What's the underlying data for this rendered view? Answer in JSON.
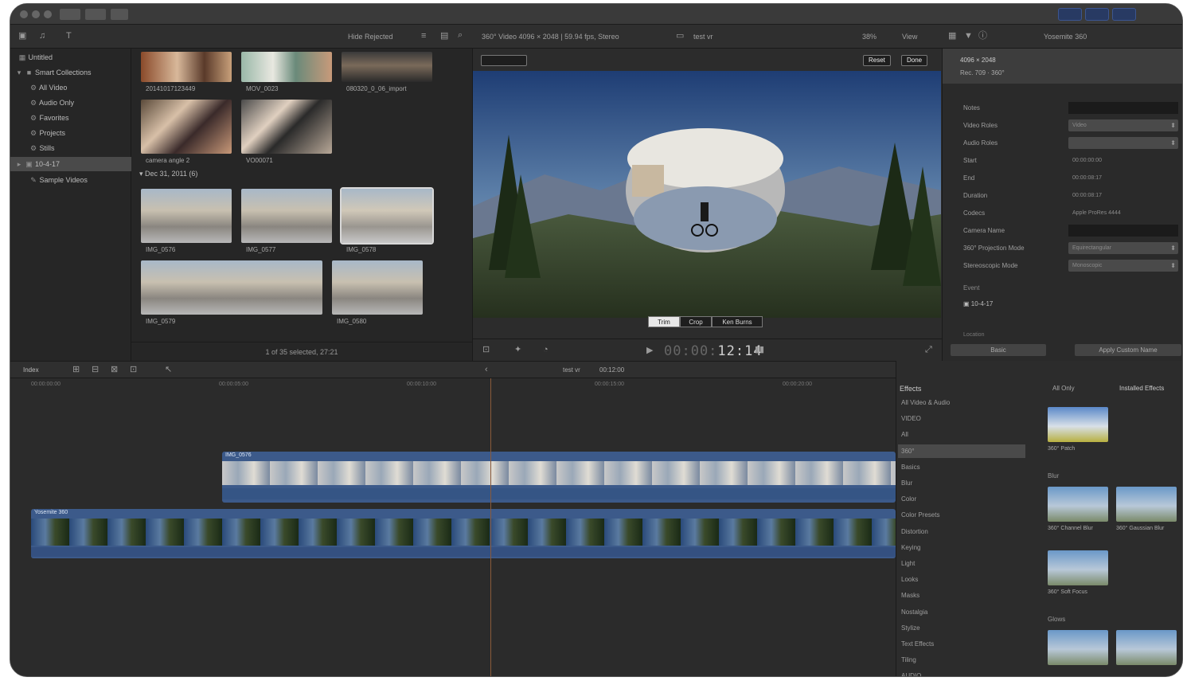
{
  "toolbar": {
    "filter": "Hide Rejected",
    "clip_info": "360° Video 4096 × 2048 | 59.94 fps, Stereo",
    "viewer_label": "test vr",
    "zoom": "38%",
    "view_menu": "View",
    "inspector_title": "Yosemite 360"
  },
  "sidebar": {
    "items": [
      {
        "label": "Untitled",
        "icon": "library-icon"
      },
      {
        "label": "Smart Collections",
        "icon": "folder-icon"
      },
      {
        "label": "All Video",
        "icon": "smart-collection-icon"
      },
      {
        "label": "Audio Only",
        "icon": "smart-collection-icon"
      },
      {
        "label": "Favorites",
        "icon": "smart-collection-icon"
      },
      {
        "label": "Projects",
        "icon": "smart-collection-icon"
      },
      {
        "label": "Stills",
        "icon": "smart-collection-icon"
      },
      {
        "label": "10-4-17",
        "icon": "event-icon"
      },
      {
        "label": "Sample Videos",
        "icon": "keyword-icon"
      }
    ]
  },
  "browser": {
    "clips_top": [
      "20141017123449",
      "MOV_0023",
      "080320_0_06_import"
    ],
    "clips_mid": [
      "camera angle 2",
      "VO00071"
    ],
    "group_header": "Dec 31, 2011  (6)",
    "clips_group": [
      "IMG_0576",
      "IMG_0577",
      "IMG_0578",
      "IMG_0579",
      "IMG_0580"
    ],
    "status": "1 of 35 selected, 27:21"
  },
  "viewer": {
    "top_buttons": [
      "Reset",
      "Done"
    ],
    "mode_tabs": [
      "Trim",
      "Crop",
      "Ken Burns"
    ],
    "timecode_dim": "00:00:",
    "timecode": "12:14"
  },
  "inspector": {
    "header_title": "4096 × 2048",
    "header_sub": "Rec. 709 · 360°",
    "rows": [
      {
        "key": "Notes",
        "value": "",
        "style": "dark"
      },
      {
        "key": "Video Roles",
        "value": "Video",
        "style": "pop"
      },
      {
        "key": "Audio Roles",
        "value": "",
        "style": "pop"
      },
      {
        "key": "Start",
        "value": "00:00:00:00",
        "style": "plain"
      },
      {
        "key": "End",
        "value": "00:00:08:17",
        "style": "plain"
      },
      {
        "key": "Duration",
        "value": "00:00:08:17",
        "style": "plain"
      },
      {
        "key": "Codecs",
        "value": "Apple ProRes 4444",
        "style": "plain"
      },
      {
        "key": "Camera Name",
        "value": "",
        "style": "dark"
      },
      {
        "key": "360° Projection Mode",
        "value": "Equirectangular",
        "style": "pop"
      },
      {
        "key": "Stereoscopic Mode",
        "value": "Monoscopic",
        "style": "pop"
      }
    ],
    "event_label": "Event",
    "event_value": "10-4-17",
    "location_label": "Location",
    "basic_button": "Basic",
    "apply_button": "Apply Custom Name"
  },
  "timeline": {
    "index_button": "Index",
    "project_name": "test vr",
    "project_duration": "00:12:00",
    "ruler": [
      "00:00:00:00",
      "00:00:05:00",
      "00:00:10:00",
      "00:00:15:00",
      "00:00:20:00"
    ],
    "clip_upper": "IMG_0576",
    "clip_lower": "Yosemite 360"
  },
  "effects": {
    "header": "Effects",
    "header_right": "All Only",
    "installed": "Installed Effects",
    "categories": [
      "All Video & Audio",
      "VIDEO",
      "All",
      "360°",
      "Basics",
      "Blur",
      "Color",
      "Color Presets",
      "Distortion",
      "Keying",
      "Light",
      "Looks",
      "Masks",
      "Nostalgia",
      "Stylize",
      "Text Effects",
      "Tiling",
      "AUDIO"
    ],
    "selected_category": "360°",
    "groups": [
      "Blur",
      "Glows"
    ],
    "items": [
      "360° Patch",
      "360° Channel Blur",
      "360° Gaussian Blur",
      "360° Soft Focus"
    ]
  }
}
